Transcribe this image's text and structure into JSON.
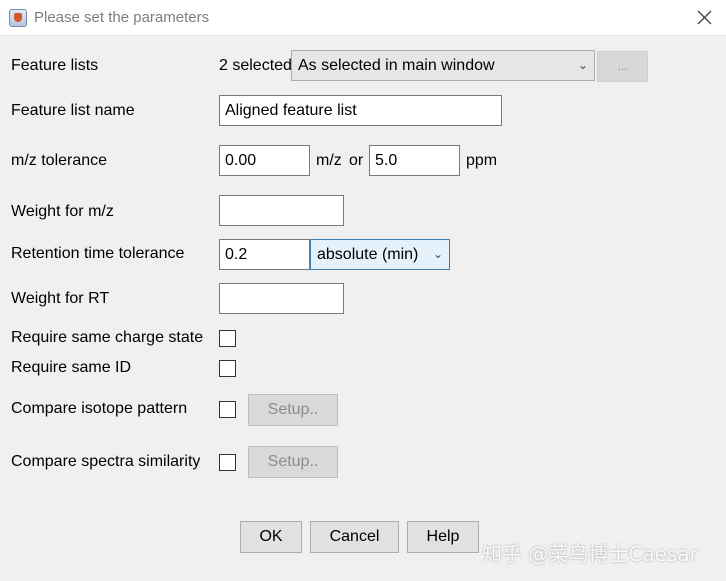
{
  "window": {
    "title": "Please set the parameters",
    "app_icon": "java-cup-icon",
    "close_icon": "close-icon"
  },
  "feature_lists": {
    "label": "Feature lists",
    "selected_count": "2 selected",
    "mode": "As selected in main window",
    "browse_label": "..."
  },
  "feature_list_name": {
    "label": "Feature list name",
    "value": "Aligned feature list"
  },
  "mz_tolerance": {
    "label": "m/z tolerance",
    "mz_value": "0.00",
    "mz_unit": "m/z",
    "or_text": "or",
    "ppm_value": "5.0",
    "ppm_unit": "ppm"
  },
  "weight_mz": {
    "label": "Weight for m/z",
    "value": ""
  },
  "rt_tolerance": {
    "label": "Retention time tolerance",
    "value": "0.2",
    "unit": "absolute (min)"
  },
  "weight_rt": {
    "label": "Weight for RT",
    "value": ""
  },
  "same_charge": {
    "label": "Require same charge state",
    "checked": false
  },
  "same_id": {
    "label": "Require same ID",
    "checked": false
  },
  "isotope": {
    "label": "Compare isotope pattern",
    "checked": false,
    "setup_label": "Setup.."
  },
  "spectra": {
    "label": "Compare spectra similarity",
    "checked": false,
    "setup_label": "Setup.."
  },
  "buttons": {
    "ok": "OK",
    "cancel": "Cancel",
    "help": "Help"
  },
  "watermark": "知乎 @菜鸟博士Caesar",
  "colors": {
    "focus_border": "#3c7fb1",
    "disabled_text": "#8c8c8c"
  }
}
